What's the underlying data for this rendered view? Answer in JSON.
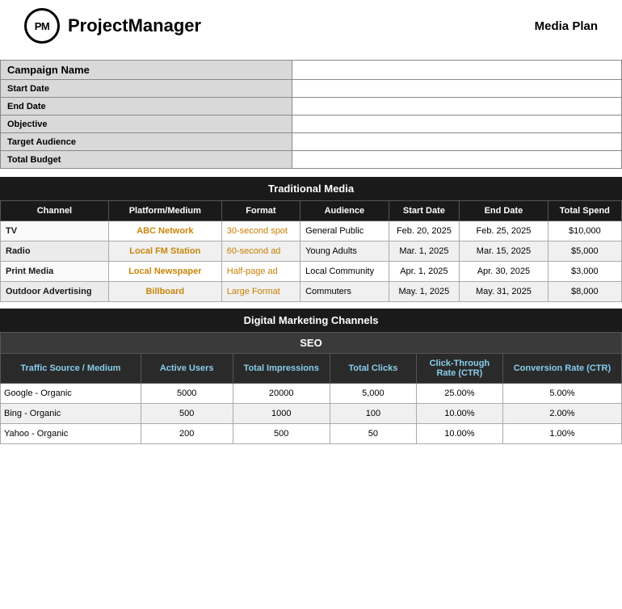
{
  "header": {
    "logo_text": "PM",
    "app_name": "ProjectManager",
    "doc_title": "Media Plan"
  },
  "campaign_info": {
    "fields": [
      {
        "label": "Campaign Name",
        "value": ""
      },
      {
        "label": "Start Date",
        "value": ""
      },
      {
        "label": "End Date",
        "value": ""
      },
      {
        "label": "Objective",
        "value": ""
      },
      {
        "label": "Target Audience",
        "value": ""
      },
      {
        "label": "Total Budget",
        "value": ""
      }
    ]
  },
  "traditional_media": {
    "section_title": "Traditional Media",
    "columns": [
      "Channel",
      "Platform/Medium",
      "Format",
      "Audience",
      "Start Date",
      "End Date",
      "Total Spend"
    ],
    "rows": [
      {
        "channel": "TV",
        "platform": "ABC Network",
        "format": "30-second spot",
        "audience": "General Public",
        "start_date": "Feb. 20, 2025",
        "end_date": "Feb. 25, 2025",
        "spend": "$10,000"
      },
      {
        "channel": "Radio",
        "platform": "Local FM Station",
        "format": "60-second ad",
        "audience": "Young Adults",
        "start_date": "Mar. 1, 2025",
        "end_date": "Mar. 15, 2025",
        "spend": "$5,000"
      },
      {
        "channel": "Print Media",
        "platform": "Local Newspaper",
        "format": "Half-page ad",
        "audience": "Local Community",
        "start_date": "Apr. 1, 2025",
        "end_date": "Apr. 30, 2025",
        "spend": "$3,000"
      },
      {
        "channel": "Outdoor Advertising",
        "platform": "Billboard",
        "format": "Large Format",
        "audience": "Commuters",
        "start_date": "May. 1, 2025",
        "end_date": "May. 31, 2025",
        "spend": "$8,000"
      }
    ]
  },
  "digital_marketing": {
    "section_title": "Digital Marketing Channels",
    "seo_label": "SEO",
    "columns": [
      "Traffic Source / Medium",
      "Active Users",
      "Total Impressions",
      "Total Clicks",
      "Click-Through Rate (CTR)",
      "Conversion Rate (CTR)"
    ],
    "rows": [
      {
        "traffic": "Google - Organic",
        "active_users": "5000",
        "impressions": "20000",
        "clicks": "5,000",
        "ctr": "25.00%",
        "conv_rate": "5.00%"
      },
      {
        "traffic": "Bing - Organic",
        "active_users": "500",
        "impressions": "1000",
        "clicks": "100",
        "ctr": "10.00%",
        "conv_rate": "2.00%"
      },
      {
        "traffic": "Yahoo - Organic",
        "active_users": "200",
        "impressions": "500",
        "clicks": "50",
        "ctr": "10.00%",
        "conv_rate": "1.00%"
      }
    ]
  }
}
